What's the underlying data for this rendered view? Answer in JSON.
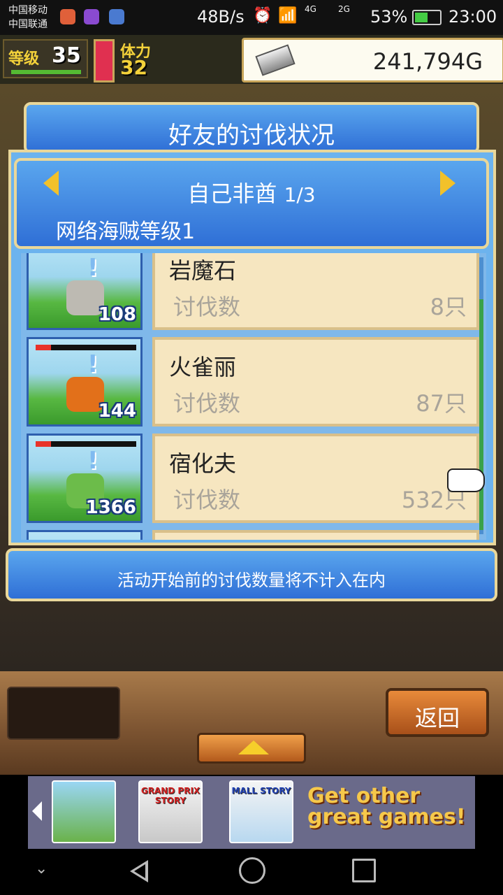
{
  "status_bar": {
    "carrier_1": "中国移动",
    "carrier_2": "中国联通",
    "net_speed": "48B/s",
    "signal_1": "4G",
    "signal_2": "2G",
    "battery": "53%",
    "time": "23:00"
  },
  "hud": {
    "level_label": "等级",
    "level_value": "35",
    "stamina_label": "体力",
    "stamina_value": "32",
    "gold_value": "241,794G"
  },
  "dialog": {
    "title": "好友的讨伐状况",
    "friend_name": "自己非酋",
    "friend_page": "1/3",
    "friend_subtitle": "网络海贼等级1",
    "entries": [
      {
        "monster_name": "岩魔石",
        "kill_label": "讨伐数",
        "kill_count": "8只",
        "thumb_count": "108",
        "color": "#bdbab2"
      },
      {
        "monster_name": "火雀丽",
        "kill_label": "讨伐数",
        "kill_count": "87只",
        "thumb_count": "144",
        "color": "#e2701a"
      },
      {
        "monster_name": "宿化夫",
        "kill_label": "讨伐数",
        "kill_count": "532只",
        "thumb_count": "1366",
        "color": "#6cbc4a"
      }
    ],
    "notice": "活动开始前的讨伐数量将不计入在内"
  },
  "bottom": {
    "back_label": "返回"
  },
  "ad": {
    "games": [
      "",
      "GRAND PRIX STORY",
      "MALL STORY"
    ],
    "cta": "Get other great games!"
  }
}
